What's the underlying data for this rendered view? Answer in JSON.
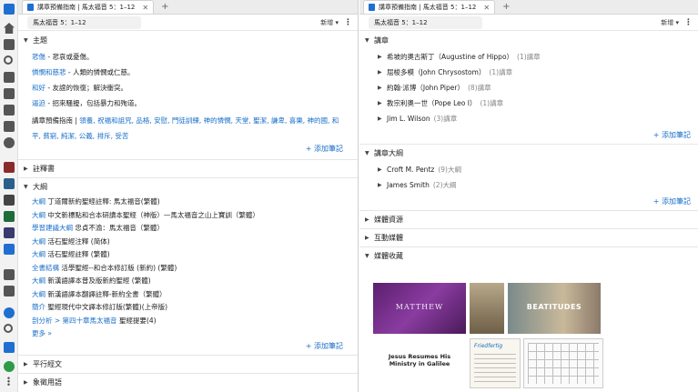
{
  "left_pane": {
    "tab_title": "講章預備指南 | 馬太福音 5：1–12",
    "reference": "馬太福音 5：1–12",
    "new_label": "新增",
    "sections": {
      "theme": {
        "title": "主題"
      },
      "commentaries": {
        "title": "註釋書"
      },
      "outlines": {
        "title": "大綱"
      },
      "parallel": {
        "title": "平行經文"
      },
      "figurative": {
        "title": "象徵用語"
      }
    },
    "themes": [
      {
        "term": "悲傷",
        "desc": " - 悲哀或憂傷。"
      },
      {
        "term": "憐憫和慈悲",
        "desc": " - 人類的憐憫或仁慈。"
      },
      {
        "term": "和好",
        "desc": " - 友誼的恢復；解決衝突。"
      },
      {
        "term": "逼迫",
        "desc": " - 招來騷擾，包括暴力和殉道。"
      }
    ],
    "guide_prefix": "講章預備指南 | ",
    "guide_links_line1": "領養, 祝福和詛咒, 品格, 安慰, 門徒訓練, 神的憐憫, 天堂, 聖潔, 謙卑, 喜樂, 神的國, 和",
    "guide_links_line2": "平, 貧窮, 純潔, 公義, 排斥, 受苦",
    "add_note": "+ 添加筆記",
    "outline_rows": [
      {
        "label": "大綱",
        "text": " 丁道爾新約聖經註釋: 馬太福音(繁體)"
      },
      {
        "label": "大綱",
        "text": " 中文新標點和合本研讀本聖經（神版）—馬太福音之山上寶訓（繁體）"
      },
      {
        "label": "學習建議大綱",
        "text": " 忠貞不渝：馬太福音（繁體）"
      },
      {
        "label": "大綱",
        "text": " 活石聖經注釋 (简体)"
      },
      {
        "label": "大綱",
        "text": " 活石聖經註釋 (繁體)"
      },
      {
        "label": "全書結構",
        "text": " 活學聖經--和合本修訂版 (新約) (繁體)"
      },
      {
        "label": "大綱",
        "text": " 新漢語譯本普及版新約聖經 (繁體)"
      },
      {
        "label": "大綱",
        "text": " 新漢語譯本翻譯註釋-新約全書（繁體）"
      },
      {
        "label": "簡介",
        "text": " 聖經現代中文譯本修訂版(繁體)(上帝版)"
      },
      {
        "label": "剖分析 > 第四十章馬太福音",
        "text": " 聖經提要(4)"
      }
    ],
    "more_label": "更多",
    "more_suffix": " »"
  },
  "right_pane": {
    "tab_title": "講章預備指南 | 馬太福音 5：1–12",
    "reference": "馬太福音 5：1–12",
    "new_label": "新增",
    "sermons_title": "講章",
    "sermon_rows": [
      {
        "name": "希坡的奧古斯丁（Augustine of Hippo）",
        "count": "(1)講章"
      },
      {
        "name": "屈梭多模（John Chrysostom）",
        "count": "(1)講章"
      },
      {
        "name": "約翰·派博（John Piper）",
        "count": "(8)講章"
      },
      {
        "name": "教宗利奧一世（Pope Leo I）",
        "count": "(1)講章"
      },
      {
        "name": "Jim L. Wilson",
        "count": "(3)講章"
      }
    ],
    "outlines_title": "講章大綱",
    "outline_rows": [
      {
        "name": "Croft M. Pentz",
        "count": "(9)大綱"
      },
      {
        "name": "James Smith",
        "count": "(2)大綱"
      }
    ],
    "add_note": "+ 添加筆記",
    "media_resources": "媒體資源",
    "interactive_media": "互動媒體",
    "media_collection": "媒體收藏",
    "media_texts": {
      "m1": "MATTHEW",
      "m3": "BEATITUDES",
      "m4_line1": "Jesus Resumes His",
      "m4_line2": "Ministry in Galilee",
      "m5": "Friedfertig"
    }
  },
  "colors": {
    "link": "#1a6fc9",
    "accent": "#1f6fd1"
  },
  "icons": [
    "logo-icon",
    "home-icon",
    "library-icon",
    "search-icon",
    "bible-icon",
    "notes-icon",
    "checklist-icon",
    "document-icon",
    "compass-icon",
    "sync-icon",
    "help-icon",
    "cart-icon",
    "user-icon",
    "more-icon"
  ]
}
